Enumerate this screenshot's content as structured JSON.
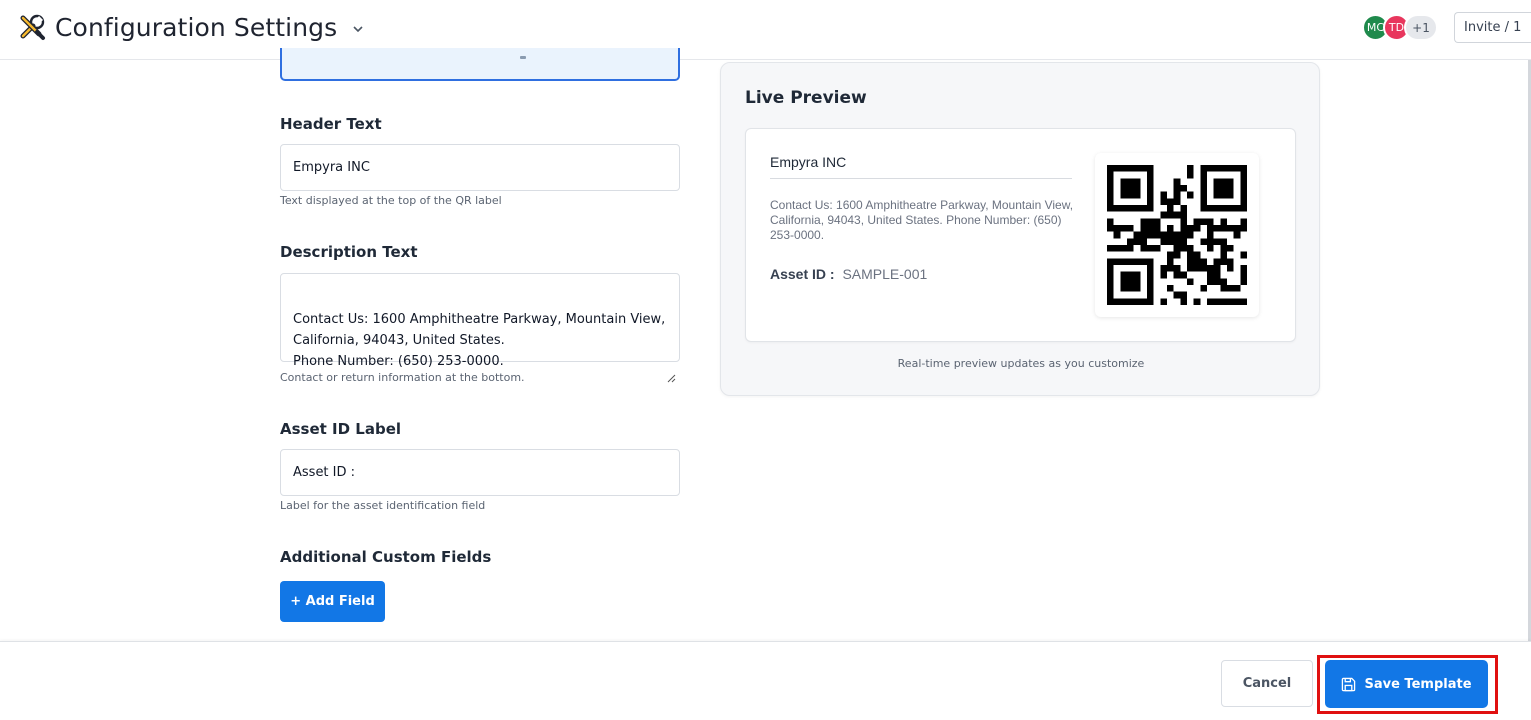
{
  "header": {
    "title": "Configuration Settings",
    "avatars": [
      {
        "initials": "MC",
        "color": "#1f8a4c"
      },
      {
        "initials": "TD",
        "color": "#e8365d"
      }
    ],
    "more_count": "+1",
    "invite_label": "Invite / 1"
  },
  "form": {
    "header_text": {
      "label": "Header Text",
      "value": "Empyra INC",
      "help": "Text displayed at the top of the QR label"
    },
    "description_text": {
      "label": "Description Text",
      "value": "Contact Us: 1600 Amphitheatre Parkway, Mountain View,\nCalifornia, 94043, United States.\nPhone Number: (650) 253-0000.",
      "help": "Contact or return information at the bottom."
    },
    "asset_id_label": {
      "label": "Asset ID Label",
      "value": "Asset ID :",
      "help": "Label for the asset identification field"
    },
    "custom_fields": {
      "label": "Additional Custom Fields",
      "add_button": "+ Add Field"
    }
  },
  "preview": {
    "title": "Live Preview",
    "header": "Empyra INC",
    "description": "Contact Us: 1600 Amphitheatre Parkway, Mountain View, California, 94043, United States. Phone Number: (650) 253-0000.",
    "asset_label": "Asset ID :",
    "asset_value": "SAMPLE-001",
    "note": "Real-time preview updates as you customize"
  },
  "footer": {
    "cancel_label": "Cancel",
    "save_label": "Save Template"
  },
  "colors": {
    "primary": "#1277e6",
    "highlight_outline": "#e01010",
    "focus_border": "#2f6fe0"
  },
  "icons": {
    "title_icon": "tools-icon",
    "title_dropdown": "chevron-down-icon",
    "save_icon": "floppy-disk-icon"
  }
}
